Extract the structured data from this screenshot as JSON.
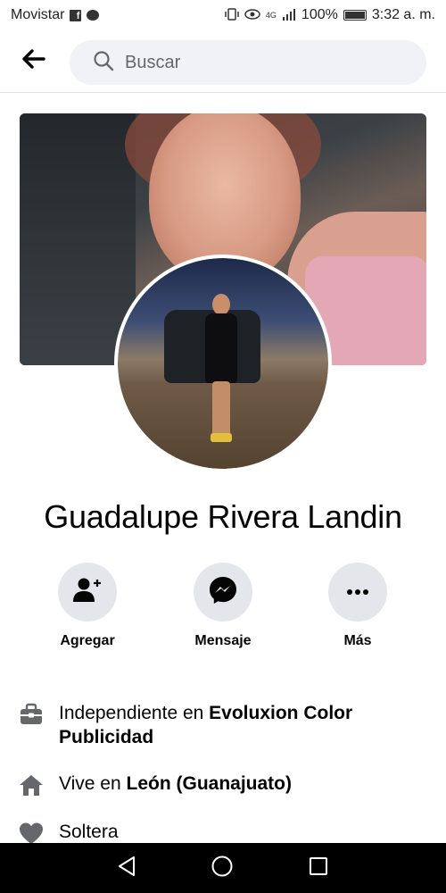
{
  "status_bar": {
    "carrier": "Movistar",
    "network": "4G",
    "battery": "100%",
    "time": "3:32 a. m."
  },
  "search": {
    "placeholder": "Buscar"
  },
  "profile": {
    "name": "Guadalupe Rivera Landin"
  },
  "actions": [
    {
      "label": "Agregar",
      "icon": "add-friend-icon"
    },
    {
      "label": "Mensaje",
      "icon": "messenger-icon"
    },
    {
      "label": "Más",
      "icon": "more-icon"
    }
  ],
  "info": {
    "work_prefix": "Independiente en ",
    "work_place": "Evoluxion Color Publicidad",
    "lives_prefix": "Vive en ",
    "lives_place": "León (Guanajuato)",
    "relationship": "Soltera"
  },
  "colors": {
    "accent": "#050505",
    "action_bg": "#e4e6eb",
    "search_bg": "#f0f2f5",
    "icon_gray": "#65676b"
  }
}
